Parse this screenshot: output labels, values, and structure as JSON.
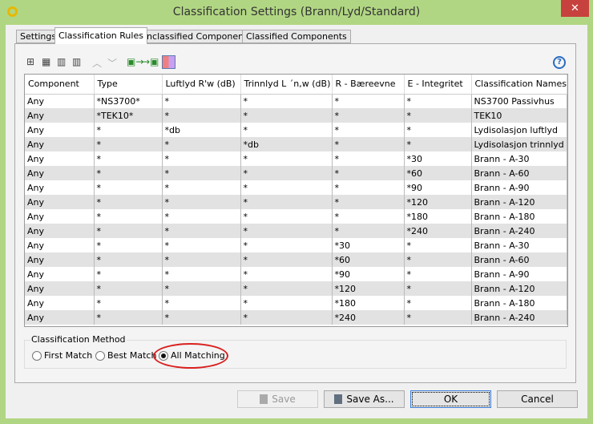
{
  "window": {
    "title": "Classification Settings (Brann/Lyd/Standard)",
    "close": "✕"
  },
  "tabs": [
    {
      "label": "Settings"
    },
    {
      "label": "Classification Rules"
    },
    {
      "label": "Unclassified Components"
    },
    {
      "label": "Classified Components"
    }
  ],
  "active_tab": "Classification Rules",
  "toolbar": {
    "help": "?"
  },
  "table": {
    "columns": [
      "Component",
      "Type",
      "Luftlyd R'w (dB)",
      "Trinnlyd L ´n,w (dB)",
      "R - Bæreevne",
      "E - Integritet",
      "Classification Names"
    ],
    "rows": [
      [
        "Any",
        "*NS3700*",
        "*",
        "*",
        "*",
        "*",
        "NS3700 Passivhus"
      ],
      [
        "Any",
        "*TEK10*",
        "*",
        "*",
        "*",
        "*",
        "TEK10"
      ],
      [
        "Any",
        "*",
        "*db",
        "*",
        "*",
        "*",
        "Lydisolasjon luftlyd"
      ],
      [
        "Any",
        "*",
        "*",
        "*db",
        "*",
        "*",
        "Lydisolasjon trinnlyd"
      ],
      [
        "Any",
        "*",
        "*",
        "*",
        "*",
        "*30",
        "Brann - A-30"
      ],
      [
        "Any",
        "*",
        "*",
        "*",
        "*",
        "*60",
        "Brann - A-60"
      ],
      [
        "Any",
        "*",
        "*",
        "*",
        "*",
        "*90",
        "Brann - A-90"
      ],
      [
        "Any",
        "*",
        "*",
        "*",
        "*",
        "*120",
        "Brann - A-120"
      ],
      [
        "Any",
        "*",
        "*",
        "*",
        "*",
        "*180",
        "Brann - A-180"
      ],
      [
        "Any",
        "*",
        "*",
        "*",
        "*",
        "*240",
        "Brann - A-240"
      ],
      [
        "Any",
        "*",
        "*",
        "*",
        "*30",
        "*",
        "Brann - A-30"
      ],
      [
        "Any",
        "*",
        "*",
        "*",
        "*60",
        "*",
        "Brann - A-60"
      ],
      [
        "Any",
        "*",
        "*",
        "*",
        "*90",
        "*",
        "Brann - A-90"
      ],
      [
        "Any",
        "*",
        "*",
        "*",
        "*120",
        "*",
        "Brann - A-120"
      ],
      [
        "Any",
        "*",
        "*",
        "*",
        "*180",
        "*",
        "Brann - A-180"
      ],
      [
        "Any",
        "*",
        "*",
        "*",
        "*240",
        "*",
        "Brann - A-240"
      ]
    ]
  },
  "method": {
    "label": "Classification Method",
    "options": [
      "First Match",
      "Best Match",
      "All Matching"
    ],
    "selected": "All Matching"
  },
  "buttons": {
    "save": "Save",
    "save_as": "Save As...",
    "ok": "OK",
    "cancel": "Cancel"
  }
}
